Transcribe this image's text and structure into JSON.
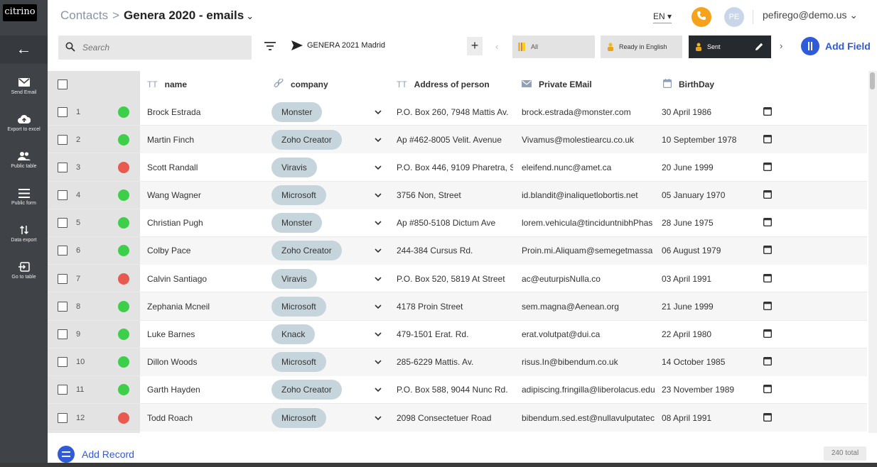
{
  "brand": {
    "logo_text": "citrino"
  },
  "header": {
    "breadcrumb_root": "Contacts",
    "breadcrumb_sep": ">",
    "title": "Genera 2020 - emails",
    "language": "EN",
    "avatar_initials": "PE",
    "user_email": "pefirego@demo.us"
  },
  "sidebar": {
    "back_icon": "arrow-left-icon",
    "items": [
      {
        "label": "Send Email",
        "icon": "envelope-icon"
      },
      {
        "label": "Export to excel",
        "icon": "cloud-upload-icon"
      },
      {
        "label": "Public table",
        "icon": "people-icon"
      },
      {
        "label": "Public form",
        "icon": "list-icon"
      },
      {
        "label": "Data export",
        "icon": "sort-arrows-icon"
      },
      {
        "label": "Go to table",
        "icon": "enter-box-icon"
      }
    ]
  },
  "toolbar": {
    "search_placeholder": "Search",
    "view_name": "GENERA 2021 Madrid",
    "add_view_label": "+",
    "views": [
      {
        "label": "All",
        "active": false
      },
      {
        "label": "Ready in English",
        "active": false
      },
      {
        "label": "Sent",
        "active": true
      }
    ],
    "add_field_label": "Add Field"
  },
  "table": {
    "columns": [
      {
        "key": "name",
        "label": "name",
        "icon": "text-type-icon"
      },
      {
        "key": "company",
        "label": "company",
        "icon": "link-icon"
      },
      {
        "key": "address",
        "label": "Address of person",
        "icon": "text-type-icon"
      },
      {
        "key": "email",
        "label": "Private EMail",
        "icon": "mail-icon"
      },
      {
        "key": "birthday",
        "label": "BirthDay",
        "icon": "calendar-icon"
      }
    ],
    "rows": [
      {
        "num": "1",
        "status": "green",
        "name": "Brock Estrada",
        "company": "Monster",
        "address": "P.O. Box 260, 7948 Mattis Av.",
        "email": "brock.estrada@monster.com",
        "birthday": "30 April 1986"
      },
      {
        "num": "2",
        "status": "green",
        "name": "Martin Finch",
        "company": "Zoho Creator",
        "address": "Ap #462-8005 Velit. Avenue",
        "email": "Vivamus@molestiearcu.co.uk",
        "birthday": "10 September 1978"
      },
      {
        "num": "3",
        "status": "red",
        "name": "Scott Randall",
        "company": "Viravis",
        "address": "P.O. Box 446, 9109 Pharetra, S",
        "email": "eleifend.nunc@amet.ca",
        "birthday": "20 June 1999"
      },
      {
        "num": "4",
        "status": "green",
        "name": "Wang Wagner",
        "company": "Microsoft",
        "address": "3756 Non, Street",
        "email": "id.blandit@inaliquetlobortis.net",
        "birthday": "05 January 1970"
      },
      {
        "num": "5",
        "status": "green",
        "name": "Christian Pugh",
        "company": "Monster",
        "address": "Ap #850-5108 Dictum Ave",
        "email": "lorem.vehicula@tinciduntnibhPhas",
        "birthday": "28 June 1975"
      },
      {
        "num": "6",
        "status": "green",
        "name": "Colby Pace",
        "company": "Zoho Creator",
        "address": "244-384 Cursus Rd.",
        "email": "Proin.mi.Aliquam@semegetmassa",
        "birthday": "06 August 1979"
      },
      {
        "num": "7",
        "status": "red",
        "name": "Calvin Santiago",
        "company": "Viravis",
        "address": "P.O. Box 520, 5819 At Street",
        "email": "ac@euturpisNulla.co",
        "birthday": "03 April 1991"
      },
      {
        "num": "8",
        "status": "green",
        "name": "Zephania Mcneil",
        "company": "Microsoft",
        "address": "4178 Proin Street",
        "email": "sem.magna@Aenean.org",
        "birthday": "21 June 1999"
      },
      {
        "num": "9",
        "status": "green",
        "name": "Luke Barnes",
        "company": "Knack",
        "address": "479-1501 Erat. Rd.",
        "email": "erat.volutpat@dui.ca",
        "birthday": "22 April 1980"
      },
      {
        "num": "10",
        "status": "green",
        "name": "Dillon Woods",
        "company": "Microsoft",
        "address": "285-6229 Mattis. Av.",
        "email": "risus.In@bibendum.co.uk",
        "birthday": "14 October 1985"
      },
      {
        "num": "11",
        "status": "green",
        "name": "Garth Hayden",
        "company": "Zoho Creator",
        "address": "P.O. Box 588, 9044 Nunc Rd.",
        "email": "adipiscing.fringilla@liberolacus.edu",
        "birthday": "23 November 1989"
      },
      {
        "num": "12",
        "status": "red",
        "name": "Todd Roach",
        "company": "Microsoft",
        "address": "2098 Consectetuer Road",
        "email": "bibendum.sed.est@nullavulputatec",
        "birthday": "08 April 1991"
      }
    ]
  },
  "footer": {
    "add_record_label": "Add Record",
    "total_label": "240 total"
  },
  "colors": {
    "accent": "#2f5bd8",
    "status_green": "#3ecf4a",
    "status_red": "#e85a4f",
    "phone": "#f7a21b",
    "pill": "#c6d4dc"
  }
}
